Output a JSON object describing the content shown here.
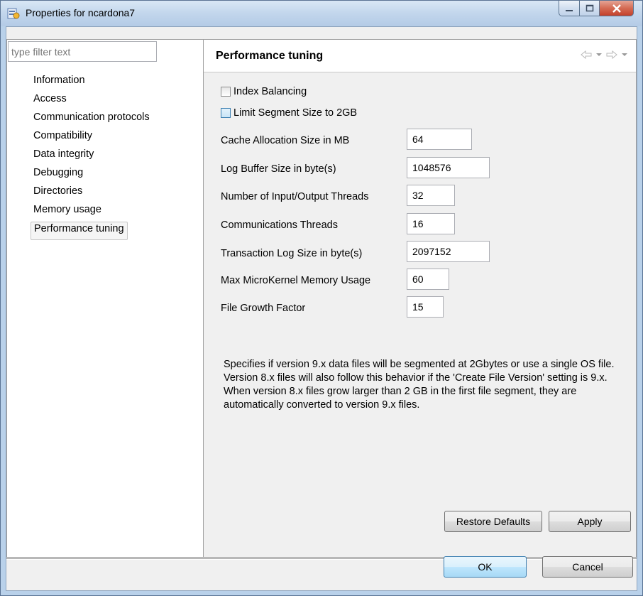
{
  "window": {
    "title": "Properties for ncardona7"
  },
  "filter": {
    "placeholder": "type filter text"
  },
  "tree": {
    "items": [
      {
        "label": "Information"
      },
      {
        "label": "Access"
      },
      {
        "label": "Communication protocols"
      },
      {
        "label": "Compatibility"
      },
      {
        "label": "Data integrity"
      },
      {
        "label": "Debugging"
      },
      {
        "label": "Directories"
      },
      {
        "label": "Memory usage"
      },
      {
        "label": "Performance tuning",
        "selected": true
      }
    ]
  },
  "page": {
    "title": "Performance tuning",
    "checkboxes": [
      {
        "label": "Index Balancing",
        "checked": false
      },
      {
        "label": "Limit Segment Size to 2GB",
        "checked": false
      }
    ],
    "fields": [
      {
        "label": "Cache Allocation Size in MB",
        "value": "64"
      },
      {
        "label": "Log Buffer Size in byte(s)",
        "value": "1048576"
      },
      {
        "label": "Number of Input/Output Threads",
        "value": "32"
      },
      {
        "label": "Communications Threads",
        "value": "16"
      },
      {
        "label": "Transaction Log Size in byte(s)",
        "value": "2097152"
      },
      {
        "label": "Max MicroKernel Memory Usage",
        "value": "60"
      },
      {
        "label": "File Growth Factor",
        "value": "15"
      }
    ],
    "description": "Specifies if version 9.x data files will be segmented at 2Gbytes or use a single OS file. Version 8.x files will also follow this behavior if the 'Create File Version' setting is 9.x. When version 8.x files grow larger than 2 GB in the first file segment, they are automatically converted to version 9.x files.",
    "restore_defaults_label": "Restore Defaults",
    "apply_label": "Apply"
  },
  "dialog": {
    "ok_label": "OK",
    "cancel_label": "Cancel"
  },
  "icons": {
    "app": "properties-icon",
    "back": "back-arrow-icon",
    "forward": "forward-arrow-icon"
  }
}
